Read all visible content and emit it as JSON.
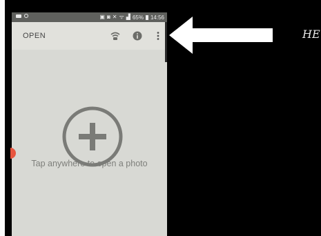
{
  "status_bar": {
    "right_icons": [
      "sim-icon",
      "nfc-icon",
      "mute-icon",
      "wifi-icon",
      "signal-icon"
    ],
    "battery": "65%",
    "time": "14:56",
    "left_icons": [
      "message-icon",
      "sync-icon"
    ]
  },
  "app_bar": {
    "open_label": "OPEN",
    "icons": [
      "wifi-camera-icon",
      "info-icon",
      "more-vert-icon"
    ]
  },
  "content": {
    "hint": "Tap anywhere to open a photo",
    "icon": "add-circle-icon"
  },
  "overlay": {
    "arrow": "arrow-left-icon",
    "logo_text": "HE"
  },
  "colors": {
    "screen_bg": "#d8d9d4",
    "status_bar_bg": "#5f605d",
    "app_bar_bg": "#e1e1dc",
    "icon": "#6c6d69",
    "accent_red": "#e8563f"
  }
}
